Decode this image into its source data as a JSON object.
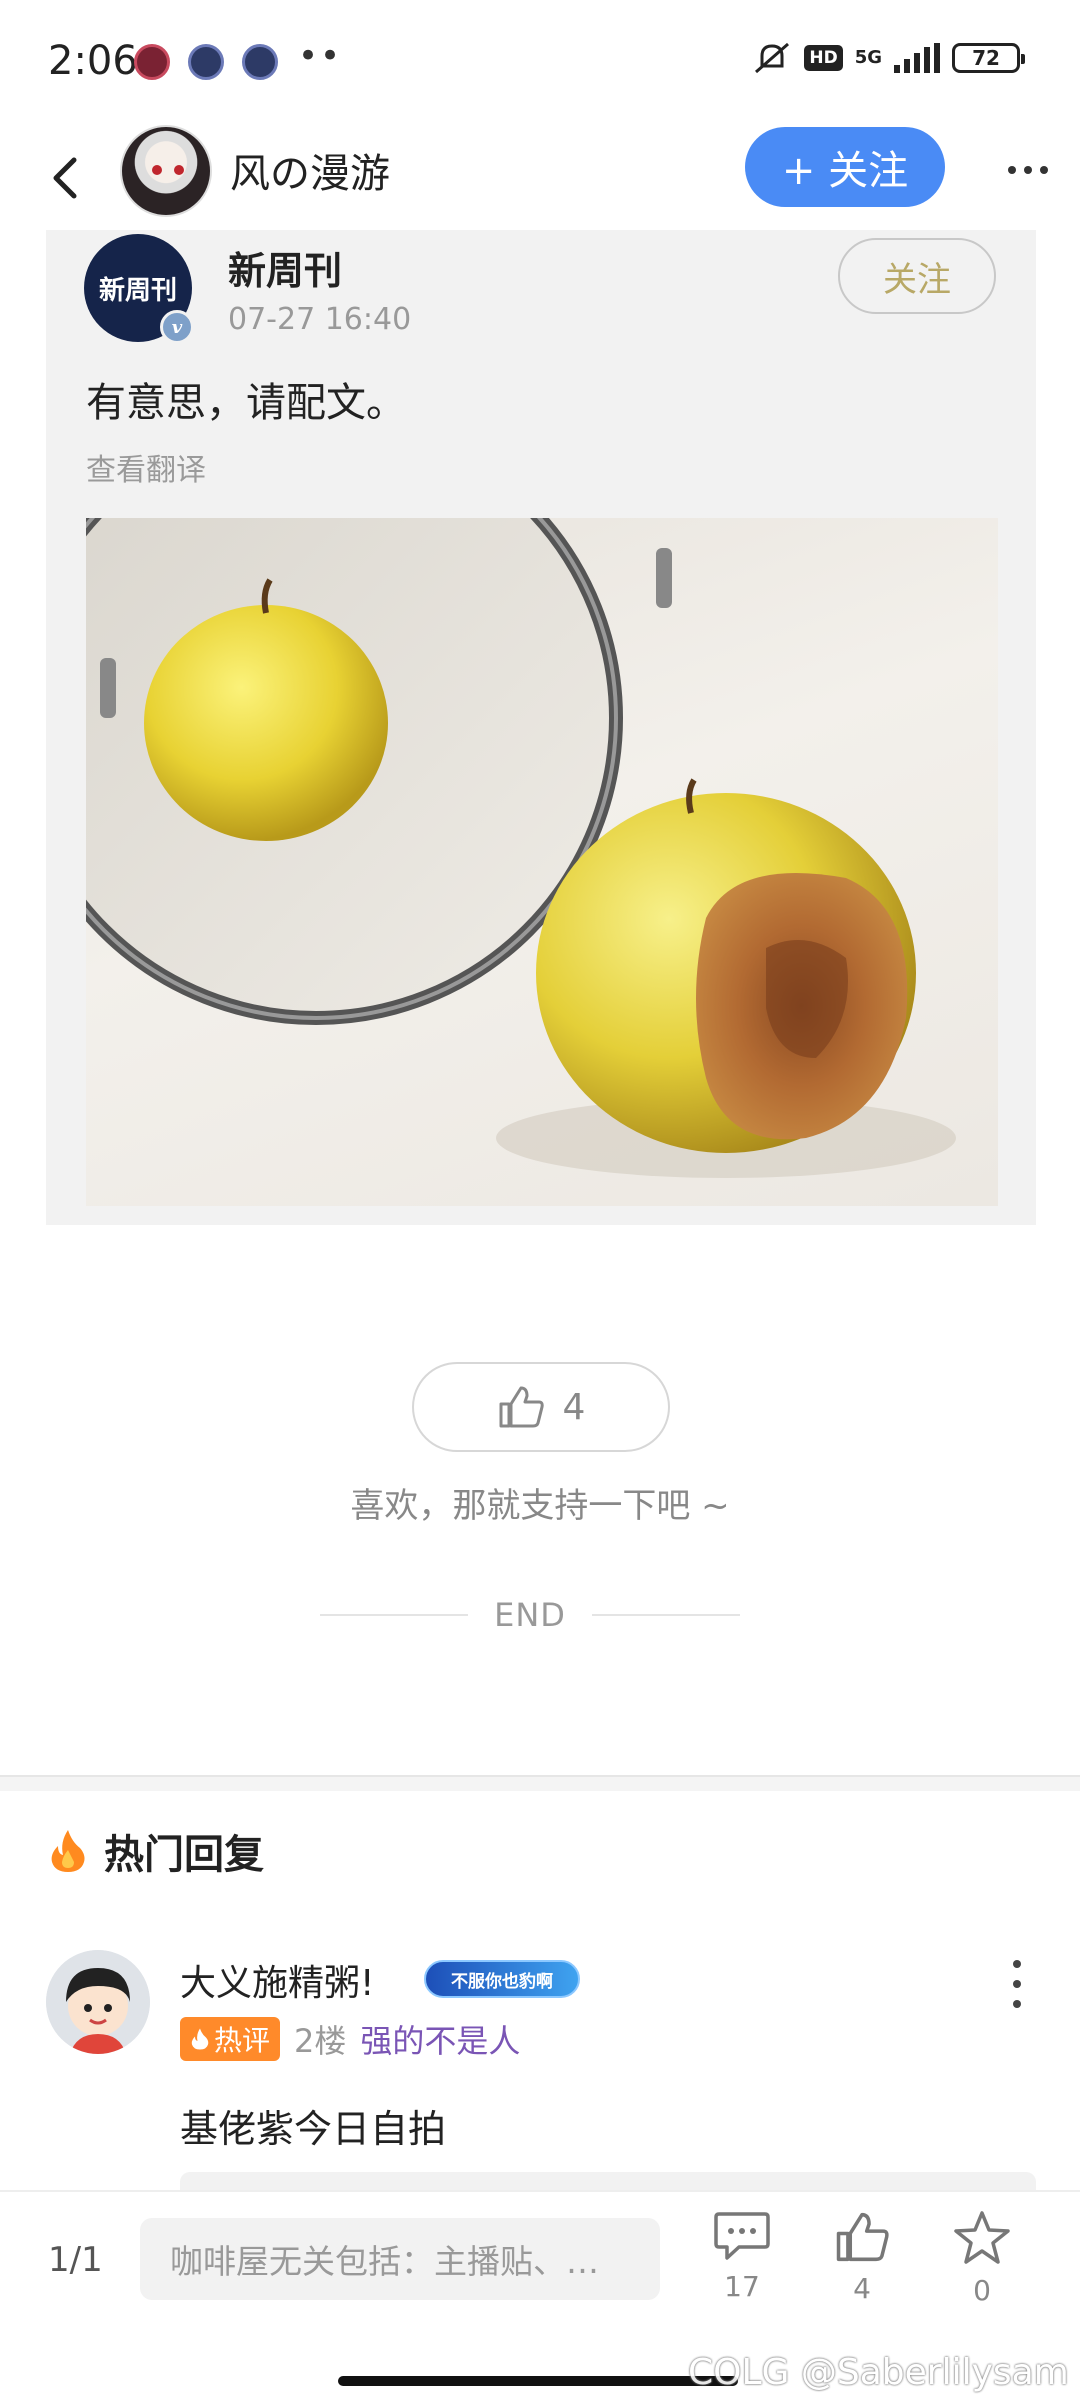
{
  "status_bar": {
    "time": "2:06",
    "network": "5G",
    "hd_label": "HD",
    "battery": "72"
  },
  "nav": {
    "title": "风の漫游",
    "follow_label": "+ 关注",
    "accent_color": "#4a8bf5"
  },
  "post": {
    "author": "新周刊",
    "avatar_text": "新周刊",
    "timestamp": "07-27 16:40",
    "follow_label": "关注",
    "text": "有意思，请配文。",
    "translate_label": "查看翻译"
  },
  "like": {
    "count": "4",
    "caption": "喜欢，那就支持一下吧 ~",
    "end_label": "END"
  },
  "hot_replies": {
    "title": "热门回复",
    "items": [
      {
        "name": "大义施精粥!",
        "medal": "不服你也豹啊",
        "hot_label": "热评",
        "floor": "2楼",
        "tag": "强的不是人",
        "text": "基佬紫今日自拍"
      }
    ]
  },
  "bottom_bar": {
    "page": "1/1",
    "input_placeholder": "咖啡屋无关包括：主播贴、…",
    "comment_count": "17",
    "like_count": "4",
    "favorite_count": "0"
  },
  "watermark": "@Saberlilysam",
  "watermark_logo": "COLG"
}
